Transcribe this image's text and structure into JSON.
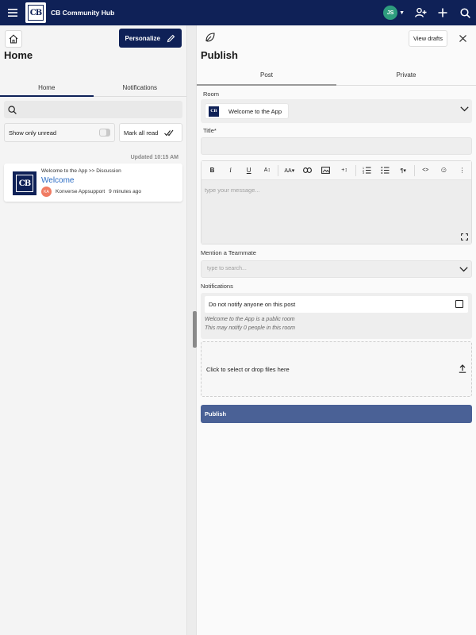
{
  "topbar": {
    "title": "CB Community Hub",
    "logo_text": "CB",
    "user_initials": "JS",
    "avatar_color": "#2e9d7e",
    "bg_color": "#0f2157"
  },
  "left": {
    "title": "Home",
    "personalize_label": "Personalize",
    "tabs": [
      {
        "label": "Home",
        "active": true
      },
      {
        "label": "Notifications",
        "active": false
      }
    ],
    "show_only_unread_label": "Show only unread",
    "mark_all_read_label": "Mark all read",
    "updated_text": "Updated 10:15 AM",
    "feed": [
      {
        "breadcrumb": "Welcome to the App >> Discussion",
        "title": "Welcome",
        "author_initials": "KA",
        "author": "Konverse Appsupport",
        "time": "9 minutes ago"
      }
    ]
  },
  "right": {
    "title": "Publish",
    "view_drafts_label": "View drafts",
    "tabs": [
      {
        "label": "Post",
        "active": true
      },
      {
        "label": "Private",
        "active": false
      }
    ],
    "room_label": "Room",
    "room_value": "Welcome to the App",
    "title_label": "Title*",
    "toolbar": [
      {
        "icon": "bold-icon",
        "glyph": "B"
      },
      {
        "icon": "italic-icon",
        "glyph": "i"
      },
      {
        "icon": "underline-icon",
        "glyph": "U"
      },
      {
        "icon": "text-size-icon",
        "glyph": "A↕"
      },
      {
        "icon": "font-icon",
        "glyph": "AA▾"
      },
      {
        "icon": "link-icon",
        "glyph": "🔗"
      },
      {
        "icon": "image-icon",
        "glyph": "▣"
      },
      {
        "icon": "insert-icon",
        "glyph": "+↕"
      },
      {
        "icon": "ordered-list-icon",
        "glyph": "1≡"
      },
      {
        "icon": "bullet-list-icon",
        "glyph": "•≡"
      },
      {
        "icon": "paragraph-icon",
        "glyph": "¶▾"
      },
      {
        "icon": "code-icon",
        "glyph": "<>"
      },
      {
        "icon": "emoji-icon",
        "glyph": "☺"
      },
      {
        "icon": "more-icon",
        "glyph": "⋮"
      }
    ],
    "message_placeholder": "type your message...",
    "mention_label": "Mention a Teammate",
    "mention_placeholder": "type to search...",
    "notifications_label": "Notifications",
    "do_not_notify_label": "Do not notify anyone on this post",
    "notif_note_1": "Welcome to the App is a public room",
    "notif_note_2": "This may notify 0 people in this room",
    "dropzone_label": "Click to select or drop files here",
    "publish_label": "Publish",
    "publish_color": "#4a6196"
  }
}
